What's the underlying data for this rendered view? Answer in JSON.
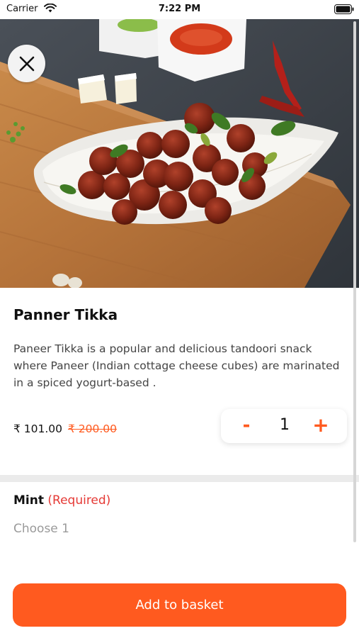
{
  "status": {
    "carrier": "Carrier",
    "time": "7:22 PM"
  },
  "dish": {
    "title": "Panner Tikka",
    "description": "Paneer Tikka is a popular and delicious tandoori snack where Paneer (Indian cottage cheese cubes) are marinated in a spiced yogurt-based .",
    "price": "₹ 101.00",
    "original_price": "₹ 200.00"
  },
  "quantity": {
    "minus": "-",
    "value": "1",
    "plus": "+"
  },
  "addon": {
    "name": "Mint",
    "required": "(Required)",
    "hint": "Choose 1"
  },
  "footer": {
    "add_label": "Add to basket"
  },
  "colors": {
    "accent": "#ff5a1f",
    "required": "#e53935"
  },
  "icons": {
    "close": "close-icon",
    "wifi": "wifi-icon",
    "battery": "battery-icon"
  }
}
